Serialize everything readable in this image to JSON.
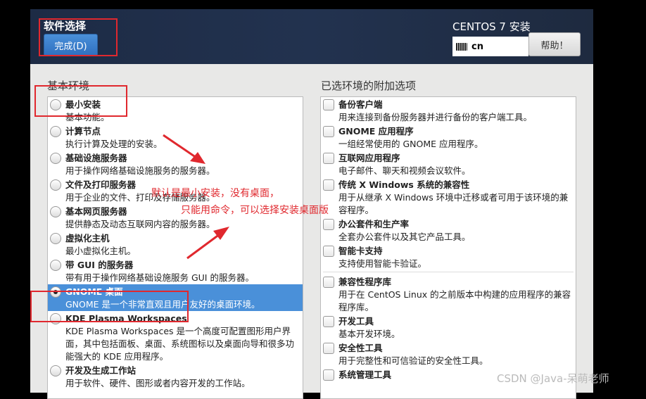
{
  "header": {
    "title": "软件选择",
    "done_label": "完成(D)",
    "product": "CENTOS 7 安装",
    "keyboard": "cn",
    "help_label": "帮助！"
  },
  "left": {
    "heading": "基本环境",
    "items": [
      {
        "name": "最小安装",
        "desc": "基本功能。",
        "selected": false
      },
      {
        "name": "计算节点",
        "desc": "执行计算及处理的安装。",
        "selected": false
      },
      {
        "name": "基础设施服务器",
        "desc": "用于操作网络基础设施服务的服务器。",
        "selected": false
      },
      {
        "name": "文件及打印服务器",
        "desc": "用于企业的文件、打印及存储服务器。",
        "selected": false
      },
      {
        "name": "基本网页服务器",
        "desc": "提供静态及动态互联网内容的服务器。",
        "selected": false
      },
      {
        "name": "虚拟化主机",
        "desc": "最小虚拟化主机。",
        "selected": false
      },
      {
        "name": "带 GUI 的服务器",
        "desc": "带有用于操作网络基础设施服务 GUI 的服务器。",
        "selected": false
      },
      {
        "name": "GNOME 桌面",
        "desc": "GNOME 是一个非常直观且用户友好的桌面环境。",
        "selected": true
      },
      {
        "name": "KDE Plasma Workspaces",
        "desc": "KDE Plasma Workspaces 是一个高度可配置图形用户界面，其中包括面板、桌面、系统图标以及桌面向导和很多功能强大的 KDE 应用程序。",
        "selected": false
      },
      {
        "name": "开发及生成工作站",
        "desc": "用于软件、硬件、图形或者内容开发的工作站。",
        "selected": false
      }
    ]
  },
  "right": {
    "heading": "已选环境的附加选项",
    "items": [
      {
        "name": "备份客户端",
        "desc": "用来连接到备份服务器并进行备份的客户端工具。",
        "checked": false
      },
      {
        "name": "GNOME 应用程序",
        "desc": "一组经常使用的 GNOME 应用程序。",
        "checked": false
      },
      {
        "name": "互联网应用程序",
        "desc": "电子邮件、聊天和视频会议软件。",
        "checked": false
      },
      {
        "name": "传统 X Windows 系统的兼容性",
        "desc": "用于从继承 X Windows 环境中迁移或者可用于该环境的兼容程序。",
        "checked": false
      },
      {
        "name": "办公套件和生产率",
        "desc": "全套办公套件以及其它产品工具。",
        "checked": false
      },
      {
        "name": "智能卡支持",
        "desc": "支持使用智能卡验证。",
        "checked": false
      },
      {
        "name": "兼容性程序库",
        "desc": "用于在 CentOS Linux 的之前版本中构建的应用程序的兼容程序库。",
        "checked": false
      },
      {
        "name": "开发工具",
        "desc": "基本开发环境。",
        "checked": false
      },
      {
        "name": "安全性工具",
        "desc": "用于完整性和可信验证的安全性工具。",
        "checked": false
      },
      {
        "name": "系统管理工具",
        "desc": "",
        "checked": false
      }
    ]
  },
  "annotation": {
    "line1": "默认是最小安装，没有桌面，",
    "line2": "只能用命令，可以选择安装桌面版",
    "color": "#e0282e"
  },
  "watermark": "CSDN @Java-呆萌老师"
}
